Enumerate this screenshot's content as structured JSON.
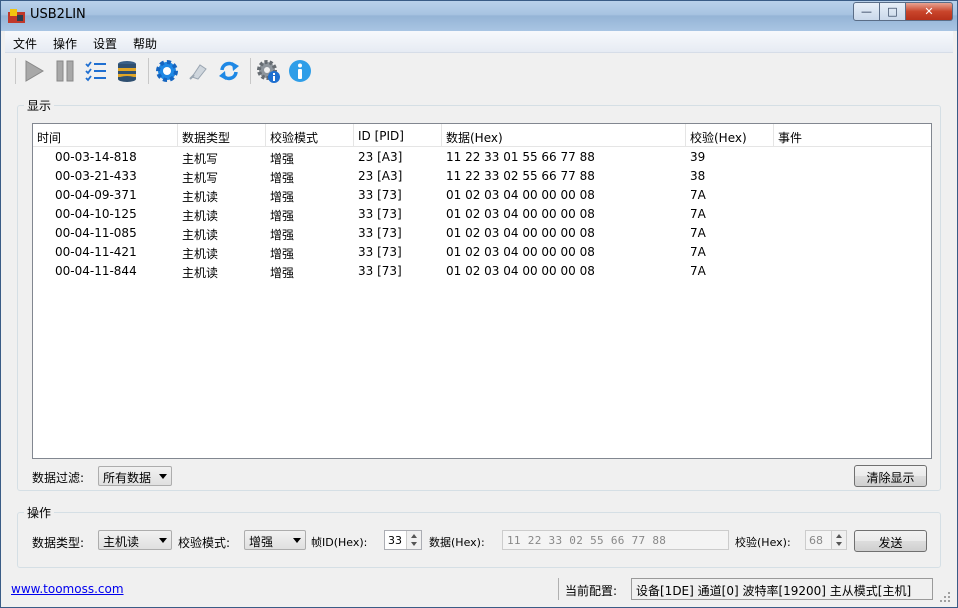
{
  "window": {
    "title": "USB2LIN"
  },
  "menu": [
    "文件",
    "操作",
    "设置",
    "帮助"
  ],
  "toolbar": {
    "icons": [
      "play-icon",
      "pause-icon",
      "checklist-icon",
      "database-icon",
      "settings-icon",
      "pin-icon",
      "refresh-icon",
      "info-gear-icon",
      "info-icon"
    ]
  },
  "display": {
    "title": "显示",
    "columns": [
      "时间",
      "数据类型",
      "校验模式",
      "ID [PID]",
      "数据(Hex)",
      "校验(Hex)",
      "事件"
    ],
    "rows": [
      [
        "00-03-14-818",
        "主机写",
        "增强",
        "23 [A3]",
        "11 22 33 01 55 66 77 88",
        "39",
        ""
      ],
      [
        "00-03-21-433",
        "主机写",
        "增强",
        "23 [A3]",
        "11 22 33 02 55 66 77 88",
        "38",
        ""
      ],
      [
        "00-04-09-371",
        "主机读",
        "增强",
        "33 [73]",
        "01 02 03 04 00 00 00 08",
        "7A",
        ""
      ],
      [
        "00-04-10-125",
        "主机读",
        "增强",
        "33 [73]",
        "01 02 03 04 00 00 00 08",
        "7A",
        ""
      ],
      [
        "00-04-11-085",
        "主机读",
        "增强",
        "33 [73]",
        "01 02 03 04 00 00 00 08",
        "7A",
        ""
      ],
      [
        "00-04-11-421",
        "主机读",
        "增强",
        "33 [73]",
        "01 02 03 04 00 00 00 08",
        "7A",
        ""
      ],
      [
        "00-04-11-844",
        "主机读",
        "增强",
        "33 [73]",
        "01 02 03 04 00 00 00 08",
        "7A",
        ""
      ]
    ],
    "filter_label": "数据过滤:",
    "filter_value": "所有数据",
    "clear_button": "清除显示"
  },
  "operation": {
    "title": "操作",
    "data_type_label": "数据类型:",
    "data_type_value": "主机读",
    "check_mode_label": "校验模式:",
    "check_mode_value": "增强",
    "frame_id_label": "帧ID(Hex):",
    "frame_id_value": "33",
    "data_label": "数据(Hex):",
    "data_value": "11 22 33 02 55 66 77 88",
    "checksum_label": "校验(Hex):",
    "checksum_value": "68",
    "send_button": "发送"
  },
  "status": {
    "link": "www.toomoss.com",
    "config_label": "当前配置:",
    "config_value": "设备[1DE] 通道[0] 波特率[19200] 主从模式[主机]"
  }
}
